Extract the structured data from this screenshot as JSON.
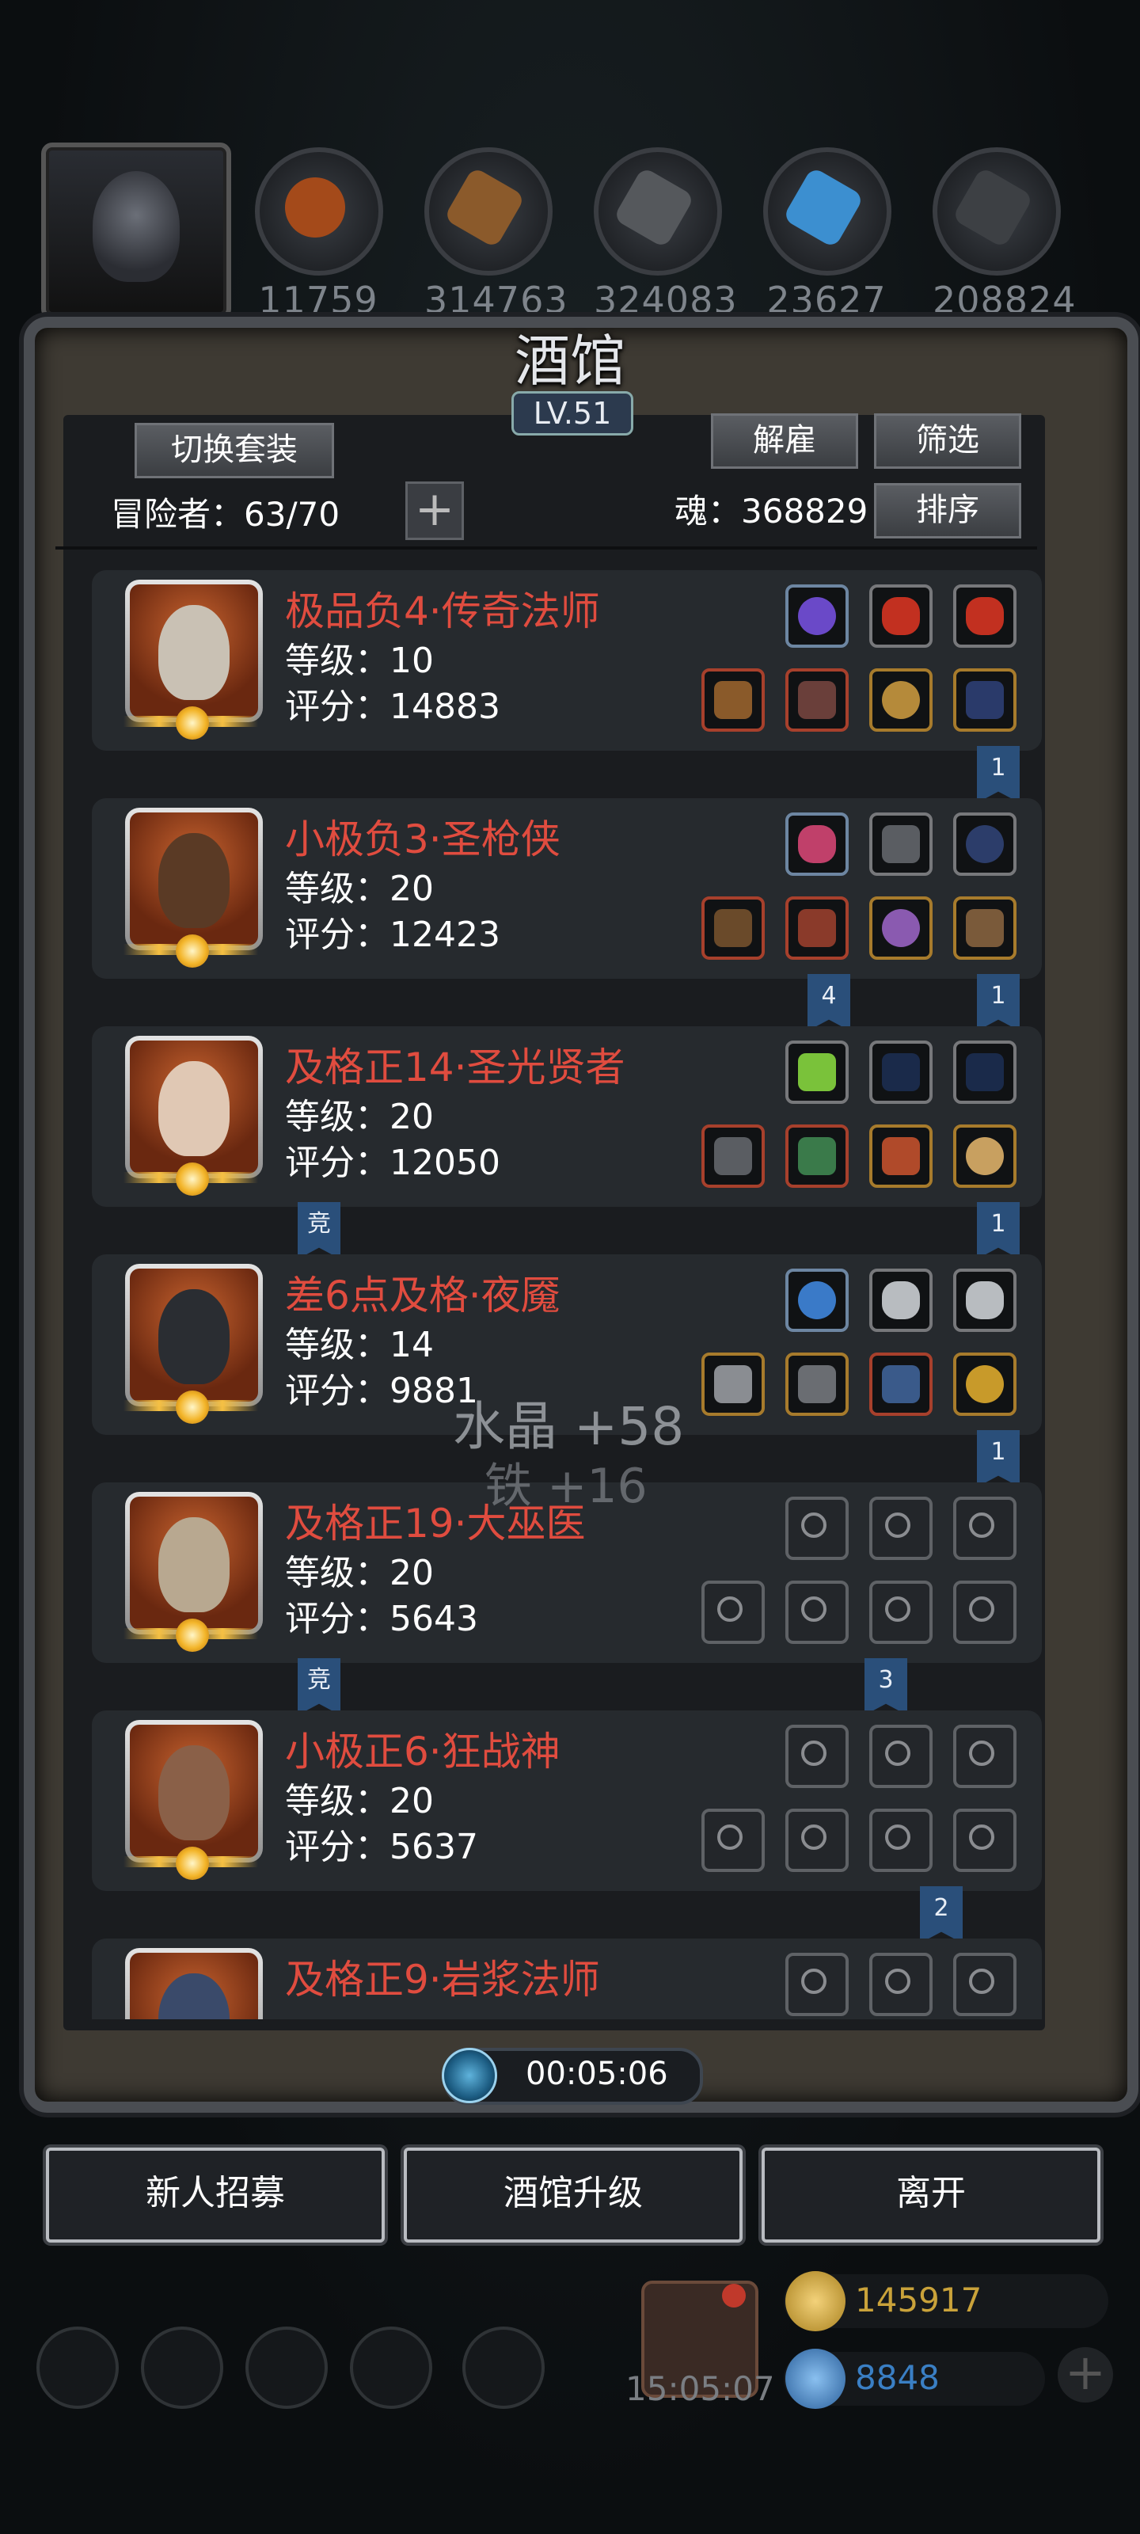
{
  "resources": {
    "values": [
      "11759",
      "314763",
      "324083",
      "23627",
      "208824"
    ]
  },
  "tavern": {
    "title": "酒馆",
    "level": "LV.51",
    "switch_set_label": "切换套装",
    "dismiss_label": "解雇",
    "filter_label": "筛选",
    "sort_label": "排序",
    "adventurers_label": "冒险者：63/70",
    "soul_label": "魂：368829"
  },
  "heroes": [
    {
      "name": "极品负4·传奇法师",
      "level": "等级：10",
      "score": "评分：14883"
    },
    {
      "name": "小极负3·圣枪侠",
      "level": "等级：20",
      "score": "评分：12423"
    },
    {
      "name": "及格正14·圣光贤者",
      "level": "等级：20",
      "score": "评分：12050"
    },
    {
      "name": "差6点及格·夜魇",
      "level": "等级：14",
      "score": "评分：9881"
    },
    {
      "name": "及格正19·大巫医",
      "level": "等级：20",
      "score": "评分：5643"
    },
    {
      "name": "小极正6·狂战神",
      "level": "等级：20",
      "score": "评分：5637"
    },
    {
      "name": "及格正9·岩浆法师",
      "level": "",
      "score": ""
    }
  ],
  "markers": {
    "m1": "1",
    "m2a": "4",
    "m2b": "1",
    "m3a": "竞",
    "m3b": "1",
    "m4": "1",
    "m5a": "竞",
    "m5b": "3",
    "m6": "2"
  },
  "popup": {
    "line1": "水晶 +58",
    "line2": "铁 +16"
  },
  "timer": "00:05:06",
  "actions": {
    "recruit": "新人招募",
    "upgrade": "酒馆升级",
    "leave": "离开"
  },
  "footer": {
    "gift_time": "15:05:07",
    "gold": "145917",
    "gems": "8848"
  },
  "colors": {
    "hero_name": "#e04c3f",
    "gold": "#c9a23a",
    "gem": "#3a7fc4"
  }
}
